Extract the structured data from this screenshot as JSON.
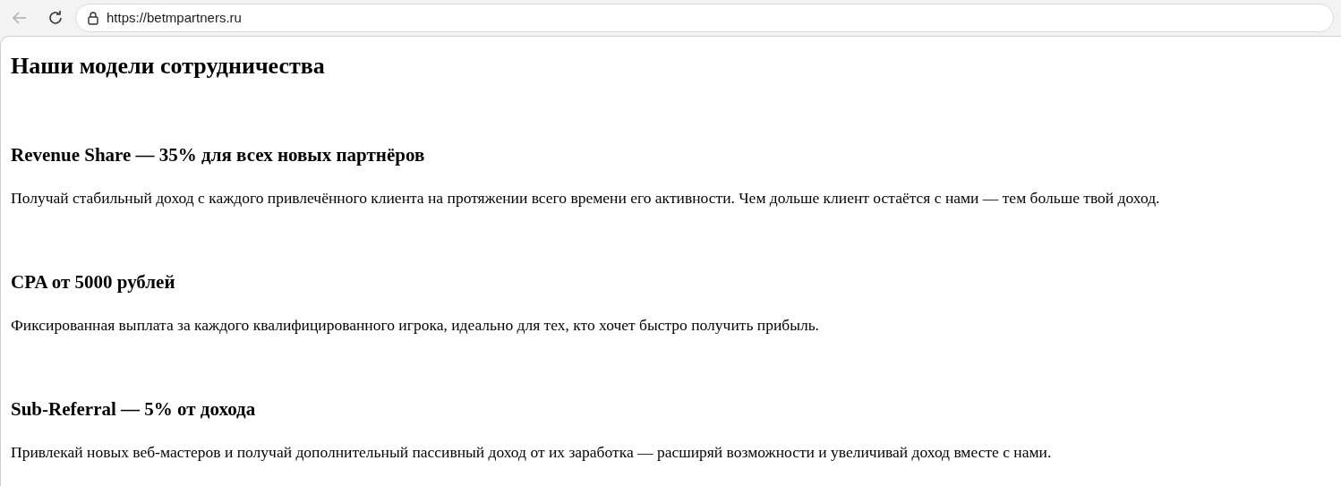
{
  "browser": {
    "back_button": {
      "disabled": true
    },
    "address": "https://betmpartners.ru"
  },
  "page": {
    "title": "Наши модели сотрудничества",
    "sections": [
      {
        "heading": "Revenue Share — 35% для всех новых партнёров",
        "text": "Получай стабильный доход с каждого привлечённого клиента на протяжении всего времени его активности. Чем дольше клиент остаётся с нами — тем больше твой доход."
      },
      {
        "heading": "CPA от 5000 рублей",
        "text": "Фиксированная выплата за каждого квалифицированного игрока, идеально для тех, кто хочет быстро получить прибыль."
      },
      {
        "heading": "Sub-Referral — 5% от дохода",
        "text": "Привлекай новых веб-мастеров и получай дополнительный пассивный доход от их заработка — расширяй возможности и увеличивай доход вместе с нами."
      }
    ]
  }
}
